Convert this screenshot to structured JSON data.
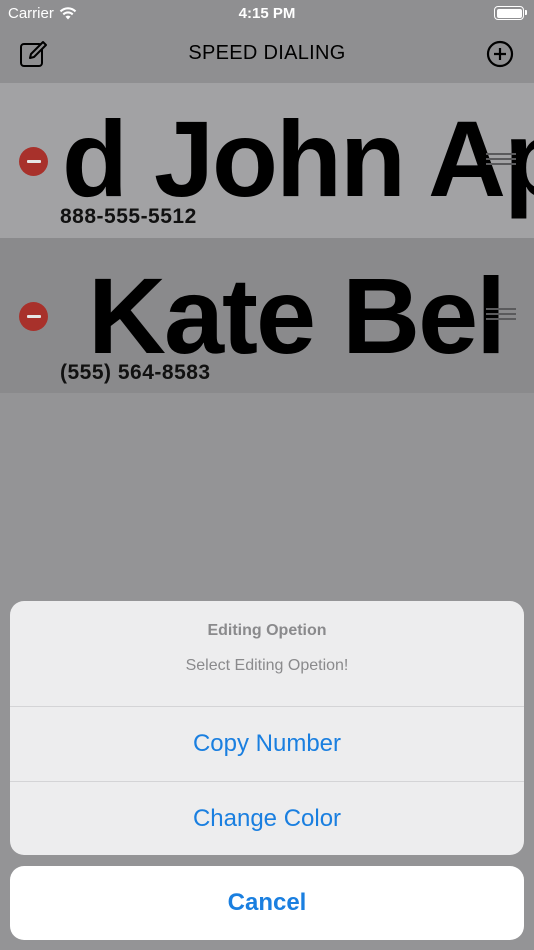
{
  "status_bar": {
    "carrier": "Carrier",
    "time": "4:15 PM"
  },
  "nav": {
    "title": "SPEED DIALING",
    "left_icon": "compose-icon",
    "right_icon": "add-circle-icon"
  },
  "contacts": [
    {
      "name_visible": "d John Ap",
      "phone": "888-555-5512"
    },
    {
      "name_visible": "Kate Bel",
      "phone": "(555) 564-8583"
    }
  ],
  "action_sheet": {
    "title": "Editing Opetion",
    "message": "Select Editing Opetion!",
    "actions": [
      "Copy Number",
      "Change Color"
    ],
    "cancel": "Cancel"
  },
  "colors": {
    "accent": "#1a7fe0",
    "delete": "#a8312b"
  }
}
